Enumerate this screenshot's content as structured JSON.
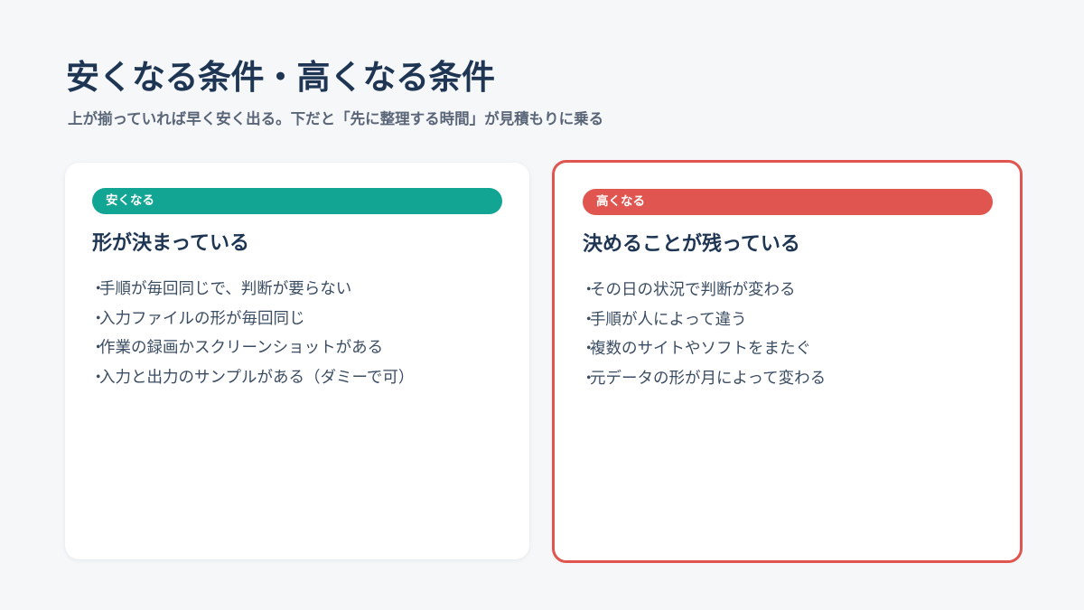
{
  "header": {
    "title": "安くなる条件・高くなる条件",
    "subtitle": "上が揃っていれば早く安く出る。下だと「先に整理する時間」が見積もりに乗る"
  },
  "cards": [
    {
      "badge": "安くなる",
      "heading": "形が決まっている",
      "accent_color": "#13a594",
      "items": [
        "手順が毎回同じで、判断が要らない",
        "入力ファイルの形が毎回同じ",
        "作業の録画かスクリーンショットがある",
        "入力と出力のサンプルがある（ダミーで可）"
      ]
    },
    {
      "badge": "高くなる",
      "heading": "決めることが残っている",
      "accent_color": "#e0554f",
      "items": [
        "その日の状況で判断が変わる",
        "手順が人によって違う",
        "複数のサイトやソフトをまたぐ",
        "元データの形が月によって変わる"
      ]
    }
  ],
  "bullet_mark": "・",
  "colors": {
    "background": "#f5f7f9",
    "text_primary": "#1e3553",
    "text_secondary": "#5a6678",
    "cheap_accent": "#13a594",
    "expensive_accent": "#e0554f"
  }
}
